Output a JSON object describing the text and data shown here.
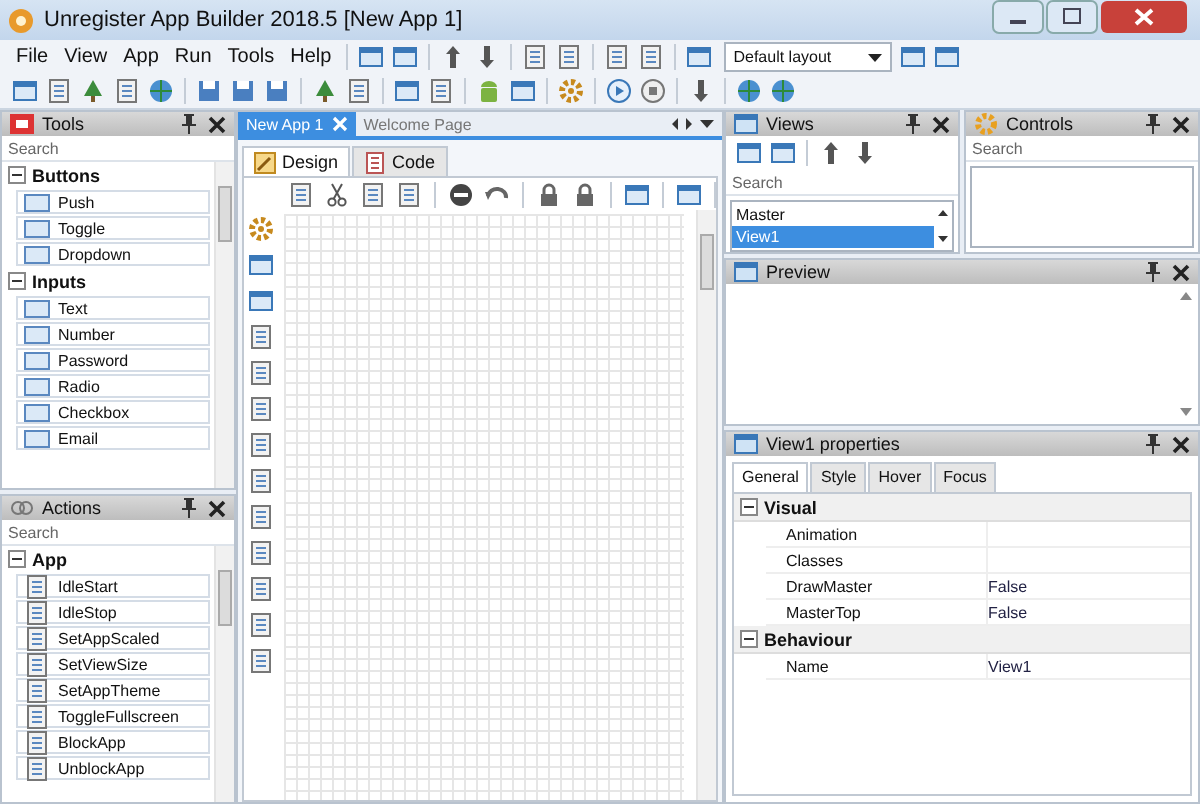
{
  "window": {
    "title": "Unregister App Builder 2018.5 [New App 1]"
  },
  "menu": [
    "File",
    "View",
    "App",
    "Run",
    "Tools",
    "Help"
  ],
  "layout_dropdown": {
    "value": "Default layout"
  },
  "tools_panel": {
    "title": "Tools",
    "search": {
      "placeholder": "Search"
    },
    "groups": [
      {
        "label": "Buttons",
        "expanded": true,
        "items": [
          "Push",
          "Toggle",
          "Dropdown"
        ]
      },
      {
        "label": "Inputs",
        "expanded": true,
        "items": [
          "Text",
          "Number",
          "Password",
          "Radio",
          "Checkbox",
          "Email"
        ]
      }
    ]
  },
  "actions_panel": {
    "title": "Actions",
    "search": {
      "placeholder": "Search"
    },
    "groups": [
      {
        "label": "App",
        "expanded": true,
        "items": [
          "IdleStart",
          "IdleStop",
          "SetAppScaled",
          "SetViewSize",
          "SetAppTheme",
          "ToggleFullscreen",
          "BlockApp",
          "UnblockApp"
        ]
      }
    ]
  },
  "document_tabs": [
    {
      "label": "New App 1",
      "selected": true
    },
    {
      "label": "Welcome Page",
      "selected": false
    }
  ],
  "editor_tabs": [
    {
      "label": "Design",
      "selected": true
    },
    {
      "label": "Code",
      "selected": false
    }
  ],
  "views_panel": {
    "title": "Views",
    "search": {
      "placeholder": "Search"
    },
    "items": [
      {
        "label": "Master",
        "selected": false
      },
      {
        "label": "View1",
        "selected": true
      }
    ]
  },
  "controls_panel": {
    "title": "Controls",
    "search": {
      "placeholder": "Search"
    }
  },
  "preview_panel": {
    "title": "Preview"
  },
  "properties_panel": {
    "title": "View1 properties",
    "tabs": [
      {
        "label": "General",
        "selected": true
      },
      {
        "label": "Style",
        "selected": false
      },
      {
        "label": "Hover",
        "selected": false
      },
      {
        "label": "Focus",
        "selected": false
      }
    ],
    "sections": [
      {
        "label": "Visual",
        "expanded": true,
        "rows": [
          {
            "name": "Animation"
          },
          {
            "name": "Classes"
          },
          {
            "name": "DrawMaster",
            "value": "False"
          },
          {
            "name": "MasterTop",
            "value": "False"
          }
        ]
      },
      {
        "label": "Behaviour",
        "expanded": true,
        "rows": [
          {
            "name": "Name",
            "value": "View1"
          }
        ]
      }
    ]
  }
}
